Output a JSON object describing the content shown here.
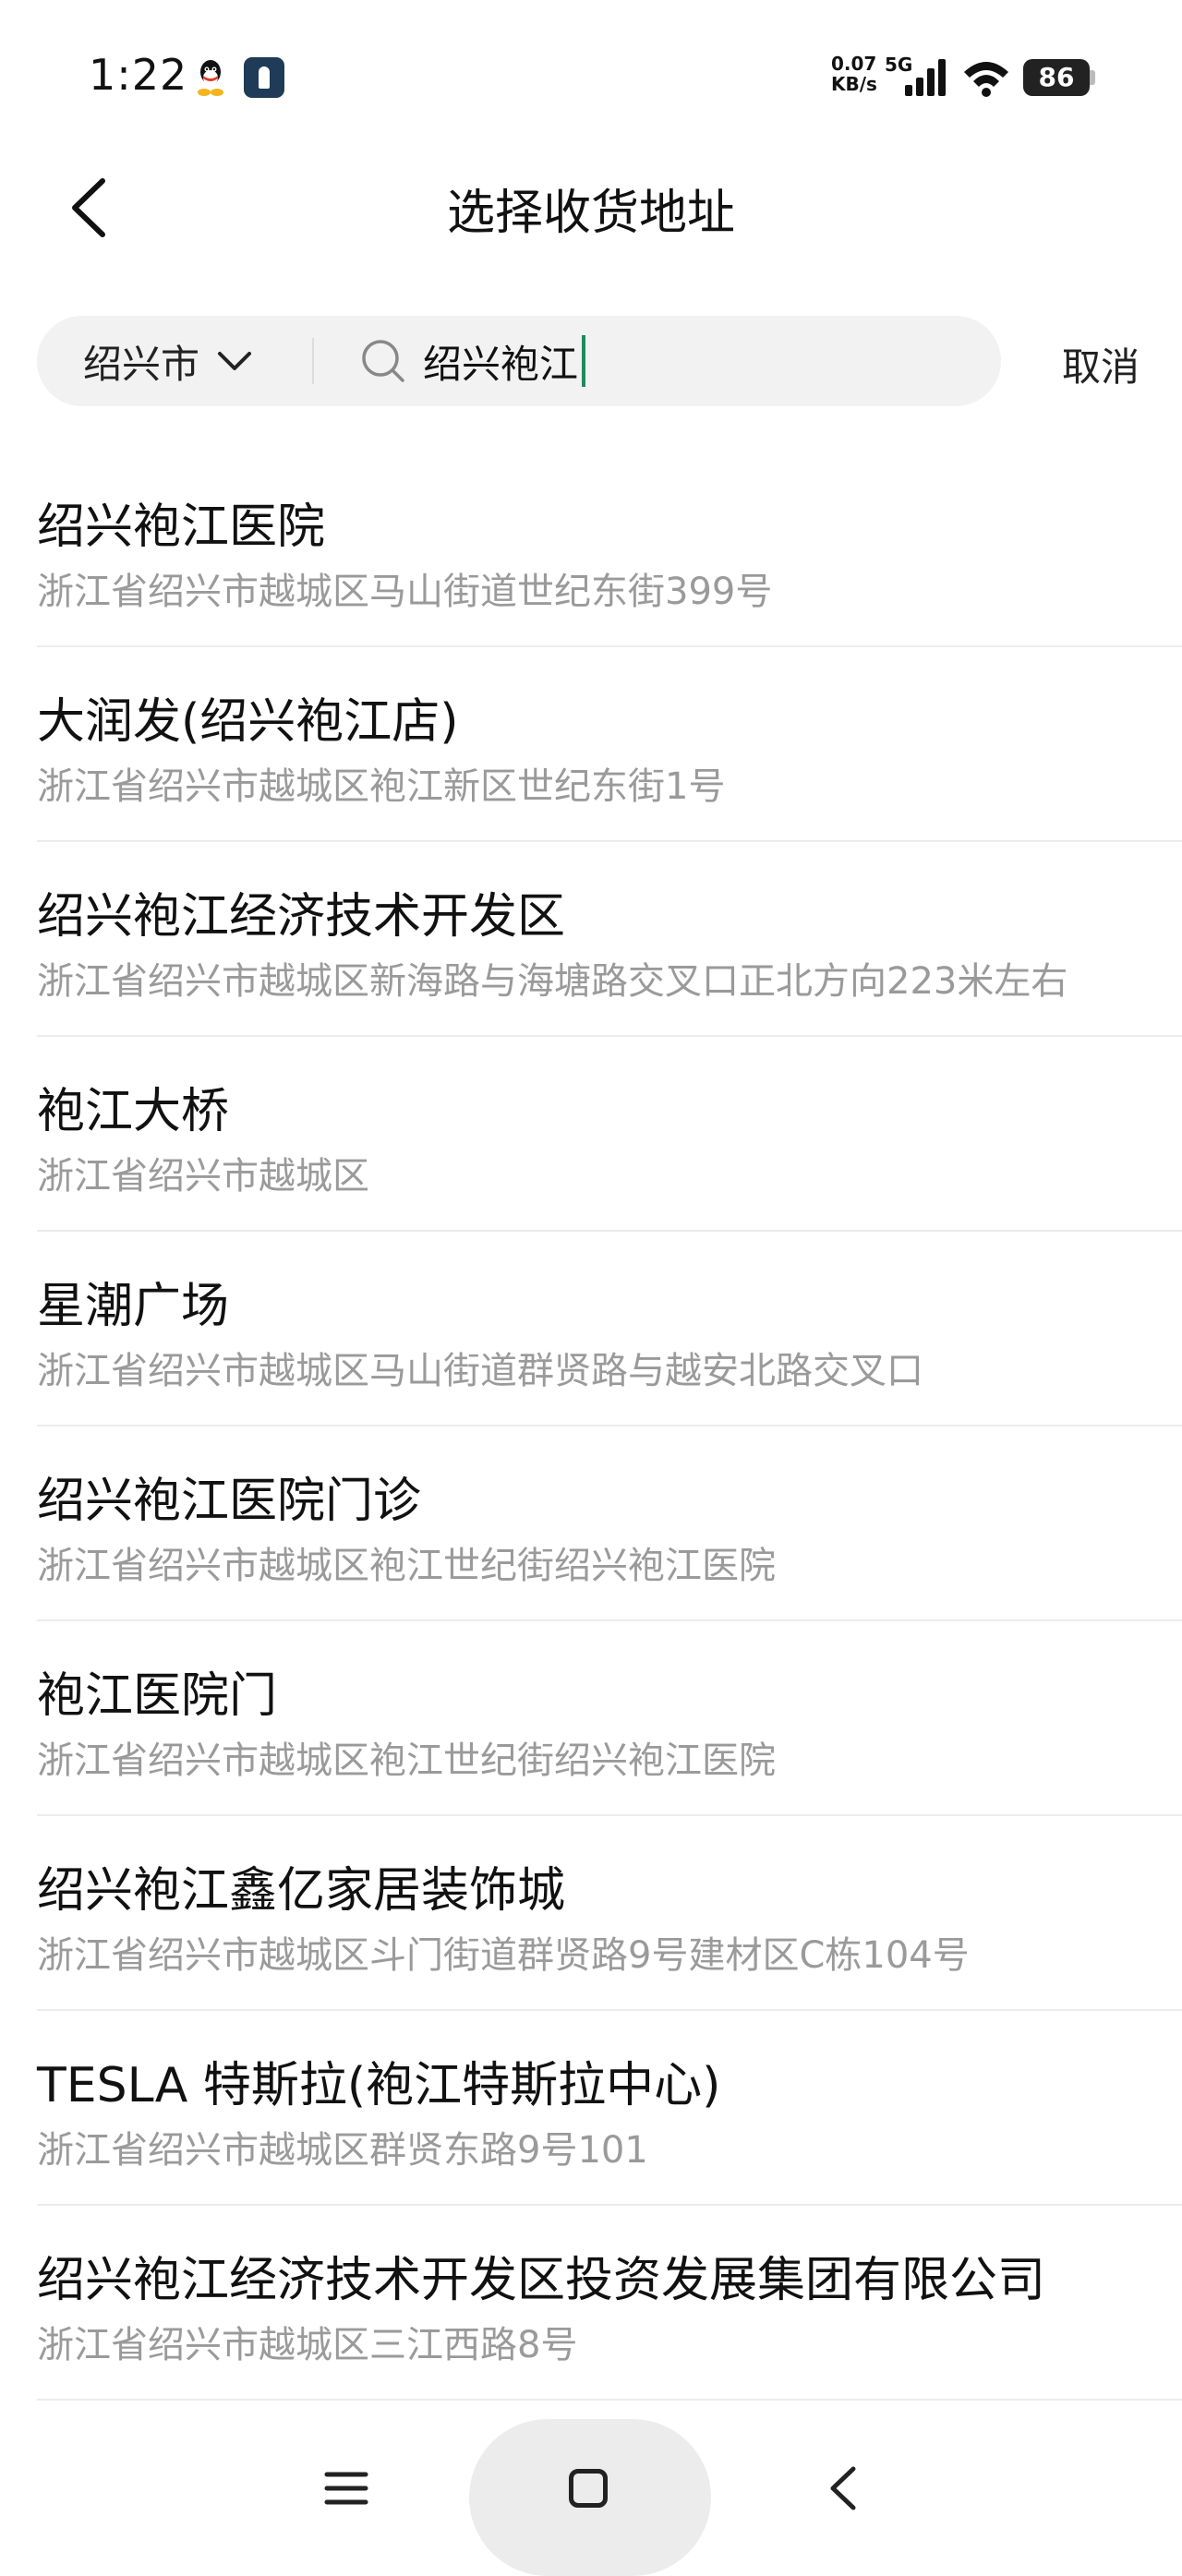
{
  "status_bar": {
    "time": "1:22",
    "net_speed_value": "0.07",
    "net_speed_unit": "KB/s",
    "network_type": "5G",
    "battery": "86"
  },
  "header": {
    "title": "选择收货地址"
  },
  "search": {
    "city": "绍兴市",
    "query": "绍兴袍江",
    "cancel_label": "取消"
  },
  "results": [
    {
      "title": "绍兴袍江医院",
      "address": "浙江省绍兴市越城区马山街道世纪东街399号"
    },
    {
      "title": "大润发(绍兴袍江店)",
      "address": "浙江省绍兴市越城区袍江新区世纪东街1号"
    },
    {
      "title": "绍兴袍江经济技术开发区",
      "address": "浙江省绍兴市越城区新海路与海塘路交叉口正北方向223米左右"
    },
    {
      "title": "袍江大桥",
      "address": "浙江省绍兴市越城区"
    },
    {
      "title": "星潮广场",
      "address": "浙江省绍兴市越城区马山街道群贤路与越安北路交叉口"
    },
    {
      "title": "绍兴袍江医院门诊",
      "address": "浙江省绍兴市越城区袍江世纪街绍兴袍江医院"
    },
    {
      "title": "袍江医院门",
      "address": "浙江省绍兴市越城区袍江世纪街绍兴袍江医院"
    },
    {
      "title": "绍兴袍江鑫亿家居装饰城",
      "address": "浙江省绍兴市越城区斗门街道群贤路9号建材区C栋104号"
    },
    {
      "title": "TESLA 特斯拉(袍江特斯拉中心)",
      "address": "浙江省绍兴市越城区群贤东路9号101"
    },
    {
      "title": "绍兴袍江经济技术开发区投资发展集团有限公司",
      "address": "浙江省绍兴市越城区三江西路8号"
    }
  ],
  "colors": {
    "caret": "#1f8a60",
    "address_text": "#9a9a9a",
    "search_bg": "#f2f2f2"
  },
  "icons": [
    "qq-icon",
    "app-badge-icon",
    "signal-icon",
    "wifi-icon",
    "back-arrow-icon",
    "chevron-down-icon",
    "search-icon",
    "menu-icon",
    "home-icon",
    "back-nav-icon"
  ]
}
